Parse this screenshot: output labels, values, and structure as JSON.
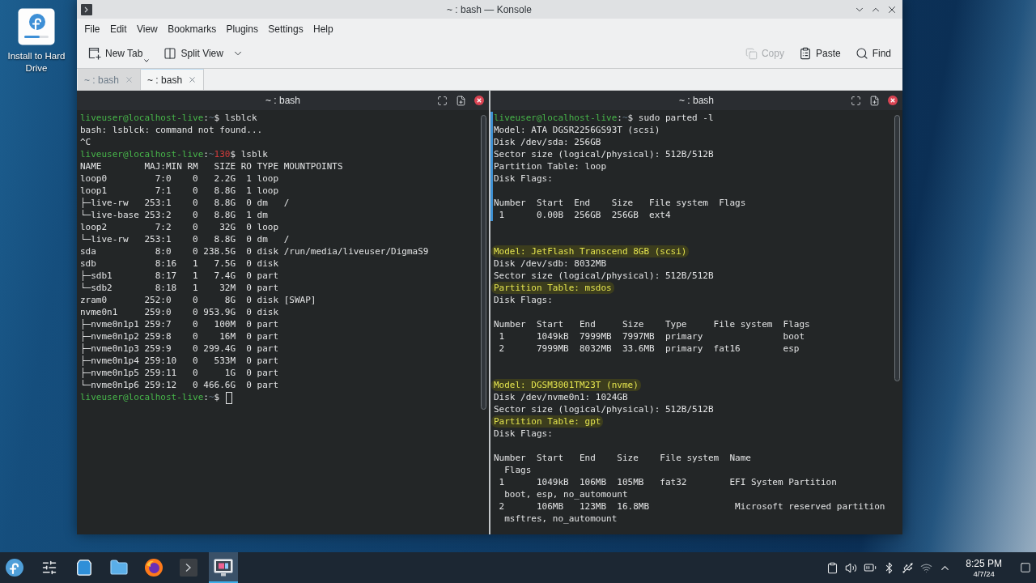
{
  "desktop": {
    "icons": [
      {
        "label": "Install to Hard Drive"
      }
    ]
  },
  "window": {
    "title": "~ : bash — Konsole",
    "menu": [
      "File",
      "Edit",
      "View",
      "Bookmarks",
      "Plugins",
      "Settings",
      "Help"
    ],
    "toolbar": {
      "left": [
        {
          "kind": "new-tab",
          "label": "New Tab",
          "disabled": false
        },
        {
          "kind": "split-view",
          "label": "Split View",
          "disabled": false
        }
      ],
      "right": [
        {
          "kind": "copy",
          "label": "Copy",
          "disabled": true
        },
        {
          "kind": "paste",
          "label": "Paste",
          "disabled": false
        },
        {
          "kind": "find",
          "label": "Find",
          "disabled": false
        }
      ]
    },
    "tabs": [
      {
        "label": "~ : bash",
        "selected": false
      },
      {
        "label": "~ : bash",
        "selected": true
      }
    ],
    "panes": [
      {
        "title": "~ : bash",
        "lines": [
          {
            "kind": "prompt",
            "user": "liveuser@localhost-live",
            "colon": ":",
            "path": "~",
            "sign": "$",
            "command": "lsblck"
          },
          {
            "kind": "output",
            "text": "bash: lsblck: command not found..."
          },
          {
            "kind": "output",
            "text": "^C"
          },
          {
            "kind": "prompt",
            "user": "liveuser@localhost-live",
            "colon": ":",
            "path": "~",
            "status": "130",
            "sign": "$",
            "command": "lsblk"
          },
          {
            "kind": "output",
            "text": "NAME        MAJ:MIN RM   SIZE RO TYPE MOUNTPOINTS"
          },
          {
            "kind": "output",
            "text": "loop0         7:0    0   2.2G  1 loop"
          },
          {
            "kind": "output",
            "text": "loop1         7:1    0   8.8G  1 loop"
          },
          {
            "kind": "output",
            "text": "├─live-rw   253:1    0   8.8G  0 dm   /"
          },
          {
            "kind": "output",
            "text": "└─live-base 253:2    0   8.8G  1 dm"
          },
          {
            "kind": "output",
            "text": "loop2         7:2    0    32G  0 loop"
          },
          {
            "kind": "output",
            "text": "└─live-rw   253:1    0   8.8G  0 dm   /"
          },
          {
            "kind": "output",
            "text": "sda           8:0    0 238.5G  0 disk /run/media/liveuser/DigmaS9"
          },
          {
            "kind": "output",
            "text": "sdb           8:16   1   7.5G  0 disk"
          },
          {
            "kind": "output",
            "text": "├─sdb1        8:17   1   7.4G  0 part"
          },
          {
            "kind": "output",
            "text": "└─sdb2        8:18   1    32M  0 part"
          },
          {
            "kind": "output",
            "text": "zram0       252:0    0     8G  0 disk [SWAP]"
          },
          {
            "kind": "output",
            "text": "nvme0n1     259:0    0 953.9G  0 disk"
          },
          {
            "kind": "output",
            "text": "├─nvme0n1p1 259:7    0   100M  0 part"
          },
          {
            "kind": "output",
            "text": "├─nvme0n1p2 259:8    0    16M  0 part"
          },
          {
            "kind": "output",
            "text": "├─nvme0n1p3 259:9    0 299.4G  0 part"
          },
          {
            "kind": "output",
            "text": "├─nvme0n1p4 259:10   0   533M  0 part"
          },
          {
            "kind": "output",
            "text": "├─nvme0n1p5 259:11   0     1G  0 part"
          },
          {
            "kind": "output",
            "text": "└─nvme0n1p6 259:12   0 466.6G  0 part"
          },
          {
            "kind": "prompt",
            "user": "liveuser@localhost-live",
            "colon": ":",
            "path": "~",
            "sign": "$",
            "cursor": true
          }
        ]
      },
      {
        "title": "~ : bash",
        "lines": [
          {
            "kind": "prompt",
            "user": "liveuser@localhost-live",
            "colon": ":",
            "path": "~",
            "sign": "$",
            "command": "sudo parted -l",
            "marked": true
          },
          {
            "kind": "output",
            "text": "Model: ATA DGSR2256GS93T (scsi)",
            "marked": true
          },
          {
            "kind": "output",
            "text": "Disk /dev/sda: 256GB",
            "marked": true
          },
          {
            "kind": "output",
            "text": "Sector size (logical/physical): 512B/512B",
            "marked": true
          },
          {
            "kind": "output",
            "text": "Partition Table: loop",
            "marked": true
          },
          {
            "kind": "output",
            "text": "Disk Flags:",
            "marked": true
          },
          {
            "kind": "blank",
            "marked": true
          },
          {
            "kind": "output",
            "text": "Number  Start  End    Size   File system  Flags",
            "marked": true
          },
          {
            "kind": "output",
            "text": " 1      0.00B  256GB  256GB  ext4",
            "marked": true
          },
          {
            "kind": "blank"
          },
          {
            "kind": "blank"
          },
          {
            "kind": "highlight",
            "text": "Model: JetFlash Transcend 8GB (scsi)"
          },
          {
            "kind": "output",
            "text": "Disk /dev/sdb: 8032MB"
          },
          {
            "kind": "output",
            "text": "Sector size (logical/physical): 512B/512B"
          },
          {
            "kind": "highlight",
            "text": "Partition Table: msdos"
          },
          {
            "kind": "output",
            "text": "Disk Flags:"
          },
          {
            "kind": "blank"
          },
          {
            "kind": "output",
            "text": "Number  Start   End     Size    Type     File system  Flags"
          },
          {
            "kind": "output",
            "text": " 1      1049kB  7999MB  7997MB  primary               boot"
          },
          {
            "kind": "output",
            "text": " 2      7999MB  8032MB  33.6MB  primary  fat16        esp"
          },
          {
            "kind": "blank"
          },
          {
            "kind": "blank"
          },
          {
            "kind": "highlight",
            "text": "Model: DGSM3001TM23T (nvme)"
          },
          {
            "kind": "output",
            "text": "Disk /dev/nvme0n1: 1024GB"
          },
          {
            "kind": "output",
            "text": "Sector size (logical/physical): 512B/512B"
          },
          {
            "kind": "highlight",
            "text": "Partition Table: gpt"
          },
          {
            "kind": "output",
            "text": "Disk Flags:"
          },
          {
            "kind": "blank"
          },
          {
            "kind": "output",
            "text": "Number  Start   End    Size    File system  Name"
          },
          {
            "kind": "output",
            "text": "  Flags"
          },
          {
            "kind": "output",
            "text": " 1      1049kB  106MB  105MB   fat32        EFI System Partition"
          },
          {
            "kind": "output",
            "text": "  boot, esp, no_automount"
          },
          {
            "kind": "output",
            "text": " 2      106MB   123MB  16.8MB                Microsoft reserved partition"
          },
          {
            "kind": "output",
            "text": "  msftres, no_automount"
          }
        ]
      }
    ]
  },
  "taskbar": {
    "apps": [
      {
        "kind": "launcher",
        "selected": false
      },
      {
        "kind": "settings",
        "selected": false
      },
      {
        "kind": "store",
        "selected": false
      },
      {
        "kind": "files",
        "selected": false
      },
      {
        "kind": "browser",
        "selected": false
      },
      {
        "kind": "terminal",
        "selected": false
      },
      {
        "kind": "screenshot",
        "selected": true
      }
    ],
    "clock": {
      "time": "8:25 PM",
      "date": "4/7/24"
    }
  }
}
